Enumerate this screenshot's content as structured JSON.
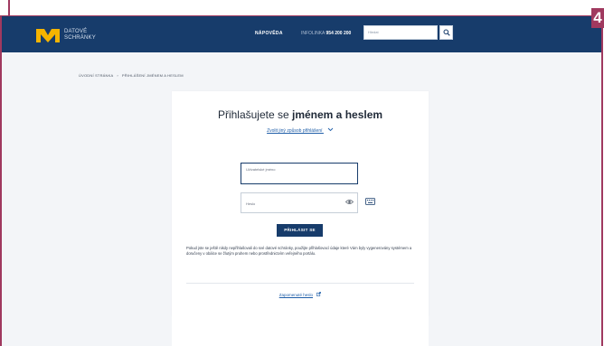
{
  "header": {
    "logo_text": "DATOVÉ\nSCHRÁNKY",
    "help_label": "NÁPOVĚDA",
    "hotline_prefix": "INFOLINKA",
    "hotline_number": "954 200 200",
    "search_placeholder": "Hledat"
  },
  "breadcrumb": {
    "home": "ÚVODNÍ STRÁNKA",
    "separator": "›",
    "current": "PŘIHLÁŠENÍ JMÉNEM A HESLEM"
  },
  "login": {
    "title_prefix": "Přihlašujete se",
    "title_bold": "jménem a heslem",
    "other_method": "Zvolit jiný způsob přihlášení",
    "username_placeholder": "Uživatelské jméno",
    "password_placeholder": "Heslo",
    "submit_label": "PŘIHLÁSIT SE",
    "info_text": "Pokud jste se ještě nikdy nepřihlašovali do své datové schránky, použijte přihlašovací údaje které Vám byly vygenerovány systémem a doručeny v obálce se žlutým pruhem nebo prostřednictvím veřejného portálu.",
    "forgot_label": "Zapomenuté heslo"
  },
  "annotation": {
    "badge": "4"
  },
  "colors": {
    "navbar": "#173c6b",
    "accent": "#1f5ea8",
    "logo_mark": "#f5b400",
    "frame": "#a0395f"
  }
}
